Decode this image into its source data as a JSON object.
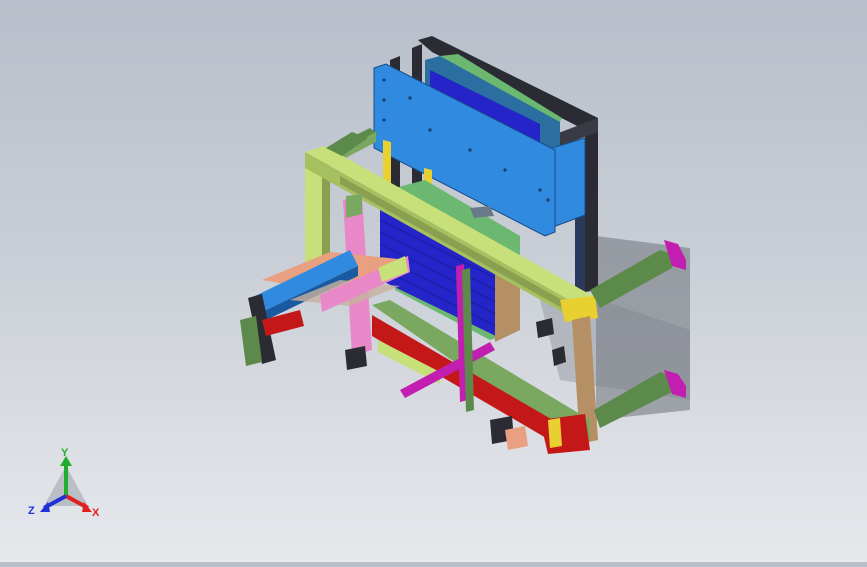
{
  "viewport": {
    "background_top": "#b8bfca",
    "background_bottom": "#e6e8ec"
  },
  "triad": {
    "x_label": "X",
    "y_label": "Y",
    "z_label": "Z",
    "x_color": "#e02020",
    "y_color": "#1fae2f",
    "z_color": "#2030d8",
    "icon": "coordinate-triad-icon"
  },
  "model": {
    "part_colors": {
      "frame_dark": "#2b2b34",
      "panel_blue": "#2f8ae0",
      "panel_deep_blue": "#2424c8",
      "beam_lime": "#c8e07a",
      "beam_olive": "#7aa860",
      "beam_green": "#5c8a4a",
      "beam_tan": "#b49064",
      "bar_magenta": "#c21fb0",
      "bar_pink": "#e888c8",
      "bar_red": "#c41818",
      "bar_yellow": "#e8d030",
      "plate_salmon": "#e8a080",
      "cabinet_green": "#6cb870",
      "shadow": "#6e727a"
    }
  }
}
